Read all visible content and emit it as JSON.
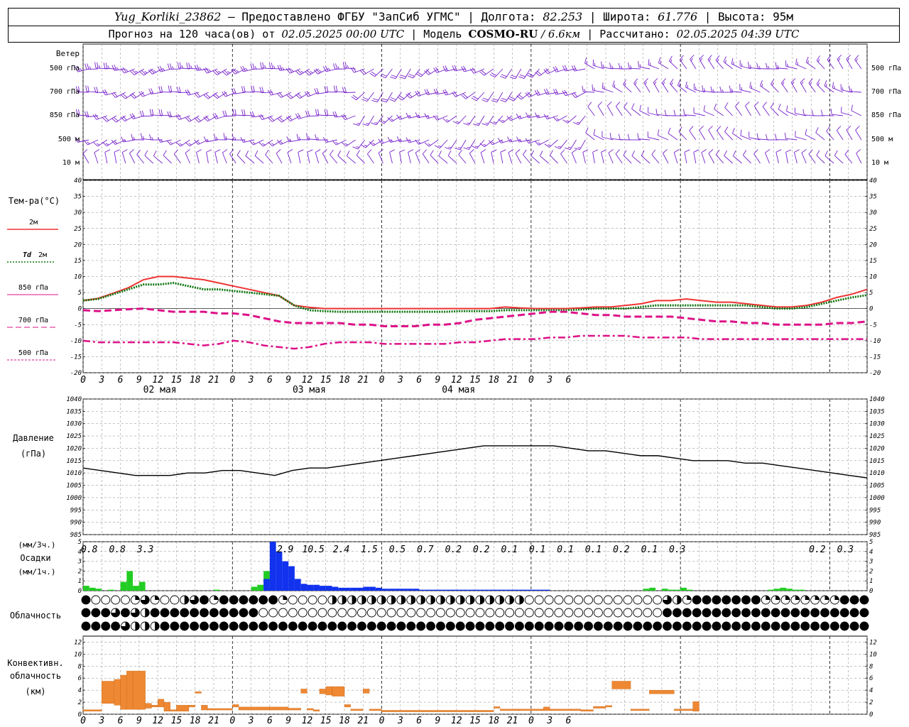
{
  "header": {
    "station": "Yug_Korliki_23862",
    "provider": " – Предоставлено ФГБУ \"ЗапСиб УГМС\" | Долгота: ",
    "lon": "82.253",
    "sep_lat": " | Широта: ",
    "lat": "61.776",
    "sep_alt": " | Высота: ",
    "alt": "95м",
    "fc_prefix": "Прогноз на 120 часа(ов) от ",
    "fc_date": "02.05.2025 00:00 UTC",
    "model_prefix": "  | Модель ",
    "model": "COSMO-RU",
    "model_res": " / 6.6км",
    "calc_prefix": " | Рассчитано: ",
    "calc_date": "02.05.2025 04:39 UTC"
  },
  "labels": {
    "wind": "Ветер",
    "wind_levels": [
      "500 гПа",
      "700 гПа",
      "850 гПа",
      "500 м",
      "10  м"
    ],
    "temp_title": "Тем-ра(°С)",
    "legend_2m": "2м",
    "legend_td": "Td",
    "legend_td2": "2м",
    "legend_850": "850 гПа",
    "legend_700": "700 гПа",
    "legend_500": "500 гПа",
    "pressure_title": "Давление",
    "pressure_unit": "(гПа)",
    "precip_u3": "(мм/3ч.)",
    "precip_title": "Осадки",
    "precip_u1": "(мм/1ч.)",
    "cloud_title": "Облачность",
    "conv_title1": "Конвективн.",
    "conv_title2": "облачность",
    "conv_unit": "(км)"
  },
  "chart_data": {
    "type": "meteogram",
    "hour_ticks": [
      "0",
      "3",
      "6",
      "9",
      "12",
      "15",
      "18",
      "21",
      "0",
      "3",
      "6",
      "9",
      "12",
      "15",
      "18",
      "21",
      "0",
      "3",
      "6",
      "9",
      "12",
      "15",
      "18",
      "21",
      "0",
      "3",
      "6"
    ],
    "day_labels": [
      "02 мая",
      "03 мая",
      "04 мая"
    ],
    "temperature": {
      "ylim": [
        -20,
        40
      ],
      "ticks": [
        -20,
        -15,
        -10,
        -5,
        0,
        5,
        10,
        15,
        20,
        25,
        30,
        35,
        40
      ],
      "series": [
        {
          "name": "2м",
          "color": "#ee3333",
          "style": "solid",
          "values": [
            2.5,
            3.2,
            4.8,
            6.5,
            9,
            10,
            10,
            9.5,
            9,
            8,
            7,
            6,
            5,
            4,
            1,
            0.4,
            0,
            0,
            0,
            0,
            0,
            0,
            0,
            0,
            0,
            0,
            0,
            0,
            0.5,
            0.2,
            0,
            0,
            0,
            0.2,
            0.5,
            0.5,
            1,
            1.5,
            2.5,
            2.5,
            3,
            2.5,
            2,
            2,
            1.5,
            1,
            0.5,
            0.5,
            1,
            2,
            3.5,
            4.5,
            6
          ]
        },
        {
          "name": "Td 2м",
          "color": "#117711",
          "style": "dotted",
          "values": [
            2.5,
            3,
            4.5,
            6,
            7.5,
            7.5,
            8,
            7,
            6,
            6,
            5.5,
            5,
            4.5,
            4,
            1,
            -0.5,
            -0.8,
            -1,
            -1,
            -1,
            -1,
            -1,
            -1,
            -1,
            -1,
            -0.8,
            -0.8,
            -0.8,
            -0.5,
            -0.5,
            -0.5,
            -0.5,
            -0.5,
            -0.3,
            0,
            0,
            0,
            0.5,
            1,
            1,
            1,
            1,
            1,
            1,
            1,
            0.5,
            0,
            0,
            0.5,
            1.5,
            2.5,
            3.5,
            4.2
          ]
        },
        {
          "name": "850 гПа",
          "color": "#dd1188",
          "style": "dash",
          "values": [
            -0.5,
            -0.8,
            -0.5,
            -0.2,
            0,
            -0.5,
            -1,
            -1,
            -1,
            -1.5,
            -1.5,
            -2,
            -3,
            -4,
            -4.5,
            -4.5,
            -4.5,
            -4.5,
            -5,
            -5,
            -5.5,
            -5.5,
            -5.5,
            -5,
            -5,
            -4.5,
            -3.5,
            -3,
            -2.5,
            -2,
            -1.5,
            -1,
            -1,
            -1.5,
            -2,
            -2,
            -2.5,
            -2.5,
            -2.5,
            -2.5,
            -3,
            -3.5,
            -4,
            -4,
            -4.5,
            -4.5,
            -5,
            -5,
            -5,
            -5,
            -4.5,
            -4.5,
            -4
          ]
        },
        {
          "name": "700 гПа",
          "color": "#dd1188",
          "style": "dashdot",
          "values": [
            -10,
            -10.5,
            -10.5,
            -10.5,
            -10.5,
            -10.5,
            -10.5,
            -11,
            -11.5,
            -11,
            -10,
            -10.5,
            -11.5,
            -12,
            -12.5,
            -12,
            -11,
            -10.5,
            -10.5,
            -10.5,
            -11,
            -11,
            -11,
            -11,
            -11,
            -10.5,
            -10.5,
            -10,
            -9.5,
            -9.5,
            -9.5,
            -9,
            -9,
            -8.5,
            -8.5,
            -8.5,
            -8.5,
            -9,
            -9,
            -9,
            -9,
            -9.5,
            -9.5,
            -9.5,
            -9.5,
            -9.5,
            -9.5,
            -9.5,
            -9.5,
            -9.5,
            -9.5,
            -9.5,
            -9.5
          ]
        }
      ]
    },
    "pressure": {
      "ylim": [
        985,
        1040
      ],
      "ticks": [
        985,
        990,
        995,
        1000,
        1005,
        1010,
        1015,
        1020,
        1025,
        1030,
        1035,
        1040
      ],
      "values": [
        1012,
        1011,
        1010,
        1009,
        1009,
        1009,
        1010,
        1010,
        1011,
        1011,
        1010,
        1009,
        1011,
        1012,
        1012,
        1013,
        1014,
        1015,
        1016,
        1017,
        1018,
        1019,
        1020,
        1021,
        1021,
        1021,
        1021,
        1021,
        1020,
        1019,
        1019,
        1018,
        1017,
        1017,
        1016,
        1015,
        1015,
        1015,
        1014,
        1014,
        1013,
        1012,
        1011,
        1010,
        1009,
        1008
      ]
    },
    "precip": {
      "ylim": [
        0,
        5
      ],
      "ticks": [
        0,
        1,
        2,
        3,
        4,
        5
      ],
      "labels_3h": [
        "0.8",
        "0.8",
        "3.3",
        "",
        "",
        "",
        "",
        "2.9",
        "10.5",
        "2.4",
        "1.5",
        "0.5",
        "0.7",
        "0.2",
        "0.2",
        "0.1",
        "0.1",
        "0.1",
        "0.1",
        "0.2",
        "0.1",
        "0.3",
        "",
        "",
        "",
        "",
        "0.2",
        "0.3"
      ],
      "green_bars": [
        0.5,
        0.3,
        0.2,
        0,
        0.1,
        0,
        0.9,
        2,
        0.5,
        0.9,
        0,
        0,
        0,
        0,
        0,
        0,
        0,
        0,
        0,
        0,
        0,
        0.1,
        0,
        0,
        0,
        0,
        0,
        0.4,
        0.6,
        2,
        0,
        0,
        0,
        0,
        0,
        0,
        0,
        0,
        0,
        0,
        0,
        0,
        0,
        0,
        0,
        0,
        0,
        0,
        0,
        0,
        0,
        0,
        0,
        0,
        0,
        0,
        0,
        0,
        0,
        0,
        0,
        0,
        0,
        0,
        0,
        0,
        0,
        0,
        0,
        0,
        0,
        0,
        0,
        0,
        0,
        0,
        0,
        0,
        0,
        0,
        0,
        0,
        0,
        0,
        0,
        0,
        0,
        0,
        0,
        0,
        0.2,
        0.3,
        0,
        0.2,
        0.1,
        0.1,
        0.3,
        0.1,
        0,
        0,
        0,
        0,
        0,
        0,
        0,
        0,
        0,
        0,
        0,
        0,
        0.1,
        0.2,
        0.3,
        0.2,
        0.1,
        0.1
      ],
      "blue_bars": [
        0,
        0,
        0,
        0,
        0,
        0,
        0,
        0,
        0,
        0,
        0,
        0,
        0,
        0,
        0,
        0,
        0,
        0,
        0,
        0,
        0,
        0,
        0,
        0,
        0,
        0,
        0,
        0,
        0,
        1.2,
        5,
        4,
        3,
        2.5,
        1.2,
        0.7,
        0.6,
        0.6,
        0.5,
        0.5,
        0.4,
        0.3,
        0.3,
        0.3,
        0.3,
        0.4,
        0.4,
        0.3,
        0.2,
        0.2,
        0.2,
        0.2,
        0.2,
        0.2,
        0.1,
        0.1,
        0.1,
        0.1,
        0.1,
        0.1,
        0.1,
        0.1,
        0.1,
        0.1,
        0.1,
        0.1,
        0.1,
        0.1,
        0.1,
        0.1,
        0.1,
        0.1,
        0.1,
        0.1,
        0.1,
        0,
        0,
        0,
        0,
        0,
        0,
        0,
        0,
        0,
        0,
        0,
        0,
        0,
        0,
        0,
        0,
        0,
        0,
        0,
        0,
        0,
        0,
        0,
        0,
        0,
        0,
        0,
        0,
        0,
        0,
        0,
        0,
        0,
        0,
        0,
        0,
        0,
        0,
        0,
        0,
        0,
        0,
        0,
        0
      ]
    },
    "cloud_rows": {
      "note": "coverage per slot in eighths (0-8), rows: high, mid, low",
      "high": [
        8,
        0,
        0,
        0,
        0,
        0,
        0,
        0,
        2,
        5,
        6,
        8,
        2,
        0,
        6,
        0,
        4,
        0,
        6,
        6,
        8,
        2,
        8,
        8,
        8,
        8,
        8,
        8,
        8,
        8,
        8,
        8,
        8,
        2,
        0,
        0,
        0,
        0,
        0,
        0,
        0,
        4,
        4,
        4,
        4,
        4,
        4,
        4,
        4,
        4,
        4,
        4,
        4,
        4,
        4,
        4,
        4,
        4,
        4,
        4,
        4,
        4,
        4,
        4,
        4,
        4,
        4,
        4,
        4,
        4,
        4,
        4,
        4,
        0,
        0,
        0,
        0,
        0,
        0,
        0,
        0,
        0,
        0,
        0,
        0,
        0,
        0,
        0,
        0,
        0,
        0,
        0,
        0,
        0,
        0,
        0,
        0,
        6,
        7,
        4,
        2,
        8,
        8,
        8,
        8,
        8,
        8,
        8,
        2,
        8,
        8,
        8,
        8,
        2,
        2,
        2,
        2,
        2,
        2,
        2,
        2,
        2,
        2,
        2,
        2,
        2,
        2,
        8,
        8,
        8,
        8
      ],
      "mid": [
        8,
        8,
        8,
        8,
        8,
        6,
        8,
        8,
        6,
        8,
        4,
        8,
        8,
        8,
        8,
        8,
        8,
        8,
        8,
        8,
        8,
        8,
        8,
        8,
        8,
        8,
        8,
        8,
        8,
        8,
        0,
        0,
        0,
        0,
        0,
        0,
        0,
        0,
        0,
        0,
        0,
        0,
        0,
        0,
        0,
        0,
        0,
        0,
        0,
        0,
        0,
        0,
        0,
        0,
        0,
        0,
        0,
        0,
        0,
        0,
        0,
        0,
        0,
        0,
        0,
        0,
        0,
        0,
        0,
        0,
        0,
        0,
        0,
        0,
        0,
        0,
        0,
        0,
        0,
        0,
        0,
        0,
        0,
        0,
        0,
        0,
        0,
        0,
        0,
        0,
        0,
        0,
        0,
        0,
        0,
        0,
        0,
        0,
        8,
        8,
        8,
        8,
        8,
        8,
        8,
        8,
        8,
        8,
        8,
        8,
        8,
        8,
        8,
        8,
        8,
        8,
        8,
        8,
        8,
        8,
        8,
        8,
        8,
        8,
        8,
        8,
        8,
        8,
        8,
        8,
        8,
        8
      ],
      "low": [
        8,
        8,
        8,
        8,
        8,
        8,
        4,
        6,
        4,
        8,
        4,
        8,
        4,
        8,
        8,
        8,
        8,
        8,
        8,
        2,
        8,
        8,
        8,
        8,
        8,
        8,
        8,
        8,
        8,
        8,
        8,
        8,
        8,
        8,
        8,
        8,
        8,
        8,
        8,
        8,
        8,
        8,
        8,
        8,
        8,
        8,
        8,
        8,
        8,
        8,
        8,
        8,
        8,
        8,
        8,
        8,
        8,
        8,
        8,
        8,
        8,
        8,
        8,
        8,
        8,
        8,
        8,
        8,
        8,
        8,
        8,
        8,
        8,
        8,
        8,
        8,
        8,
        8,
        8,
        8,
        8,
        8,
        8,
        8,
        8,
        8,
        8,
        8,
        8,
        8,
        8,
        8,
        8,
        8,
        8,
        8,
        8,
        8,
        8,
        8,
        8,
        8,
        4,
        8,
        8,
        8,
        8,
        8,
        8,
        8,
        8,
        8,
        8,
        8,
        8,
        8,
        8,
        2,
        8,
        8,
        8,
        8,
        8,
        8,
        8,
        8,
        8,
        4,
        8,
        8,
        8,
        8
      ]
    },
    "convective": {
      "ylim": [
        0,
        13
      ],
      "ticks": [
        0,
        2,
        4,
        6,
        8,
        10,
        12
      ],
      "segments": [
        {
          "h0": 0,
          "h1": 3,
          "bottom": 0.5,
          "top": 0.5
        },
        {
          "h0": 3,
          "h1": 5,
          "bottom": 1.8,
          "top": 5.5
        },
        {
          "h0": 5,
          "h1": 6,
          "bottom": 1.5,
          "top": 5.8
        },
        {
          "h0": 6,
          "h1": 7,
          "bottom": 0.8,
          "top": 6.5
        },
        {
          "h0": 7,
          "h1": 8,
          "bottom": 0.8,
          "top": 7.2
        },
        {
          "h0": 8,
          "h1": 10,
          "bottom": 0.8,
          "top": 7.2
        },
        {
          "h0": 10,
          "h1": 11,
          "bottom": 1.0,
          "top": 1.8
        },
        {
          "h0": 11,
          "h1": 12,
          "bottom": 1.2,
          "top": 1.5
        },
        {
          "h0": 12,
          "h1": 13,
          "bottom": 1.2,
          "top": 2.5
        },
        {
          "h0": 13,
          "h1": 14,
          "bottom": 0.5,
          "top": 2
        },
        {
          "h0": 14,
          "h1": 15,
          "bottom": 0.5,
          "top": 0.5
        },
        {
          "h0": 15,
          "h1": 17,
          "bottom": 0.5,
          "top": 1.5
        },
        {
          "h0": 17,
          "h1": 18,
          "bottom": 1.2,
          "top": 1.5
        },
        {
          "h0": 18,
          "h1": 19,
          "bottom": 3.5,
          "top": 3.5
        },
        {
          "h0": 19,
          "h1": 20,
          "bottom": 0.7,
          "top": 1.5
        },
        {
          "h0": 20,
          "h1": 24,
          "bottom": 0.7,
          "top": 0.9
        },
        {
          "h0": 24,
          "h1": 25,
          "bottom": 1.2,
          "top": 1.6
        },
        {
          "h0": 25,
          "h1": 30,
          "bottom": 0.7,
          "top": 1.2
        },
        {
          "h0": 30,
          "h1": 33,
          "bottom": 0.7,
          "top": 1.2
        },
        {
          "h0": 33,
          "h1": 35,
          "bottom": 0.7,
          "top": 1.0
        },
        {
          "h0": 35,
          "h1": 36,
          "bottom": 3.5,
          "top": 4.2
        },
        {
          "h0": 36,
          "h1": 37,
          "bottom": 0.7,
          "top": 0.9
        },
        {
          "h0": 37,
          "h1": 38,
          "bottom": 0.5,
          "top": 0.7
        },
        {
          "h0": 38,
          "h1": 39,
          "bottom": 3.4,
          "top": 4.2
        },
        {
          "h0": 39,
          "h1": 40,
          "bottom": 3.2,
          "top": 4.6
        },
        {
          "h0": 40,
          "h1": 42,
          "bottom": 3,
          "top": 4.6
        },
        {
          "h0": 42,
          "h1": 43,
          "bottom": 1.2,
          "top": 1.6
        },
        {
          "h0": 43,
          "h1": 45,
          "bottom": 0.6,
          "top": 0.8
        },
        {
          "h0": 45,
          "h1": 46,
          "bottom": 3.5,
          "top": 4.2
        },
        {
          "h0": 46,
          "h1": 48,
          "bottom": 0.6,
          "top": 0.8
        },
        {
          "h0": 48,
          "h1": 66,
          "bottom": 0.4,
          "top": 0.6
        },
        {
          "h0": 66,
          "h1": 67,
          "bottom": 1,
          "top": 1.1
        },
        {
          "h0": 67,
          "h1": 70,
          "bottom": 0.6,
          "top": 0.8
        },
        {
          "h0": 70,
          "h1": 74,
          "bottom": 0.6,
          "top": 0.8
        },
        {
          "h0": 74,
          "h1": 75,
          "bottom": 0.6,
          "top": 1.2
        },
        {
          "h0": 75,
          "h1": 80,
          "bottom": 0.6,
          "top": 0.8
        },
        {
          "h0": 80,
          "h1": 82,
          "bottom": 0.5,
          "top": 0.7
        },
        {
          "h0": 82,
          "h1": 84,
          "bottom": 1,
          "top": 1.3
        },
        {
          "h0": 84,
          "h1": 85,
          "bottom": 1.2,
          "top": 1.4
        },
        {
          "h0": 85,
          "h1": 88,
          "bottom": 4.2,
          "top": 5.5
        },
        {
          "h0": 88,
          "h1": 91,
          "bottom": 0.6,
          "top": 0.8
        },
        {
          "h0": 91,
          "h1": 95,
          "bottom": 3.4,
          "top": 4.0
        },
        {
          "h0": 95,
          "h1": 98,
          "bottom": 0.6,
          "top": 0.7
        },
        {
          "h0": 98,
          "h1": 99,
          "bottom": 0.5,
          "top": 2.1
        }
      ]
    },
    "colors": {
      "wind": "#7722cc",
      "t2m": "#ee3333",
      "td": "#117711",
      "pressure_level": "#dd1188",
      "precip_green": "#22cc22",
      "precip_blue": "#1133ee",
      "convective": "#ee8833",
      "grid": "#888888"
    }
  }
}
